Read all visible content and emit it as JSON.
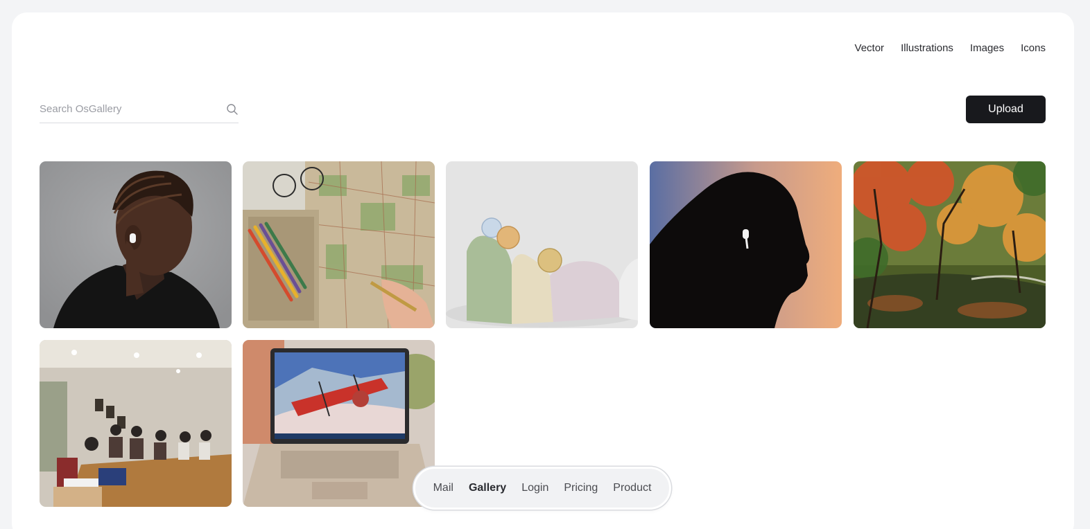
{
  "top_nav": {
    "items": [
      {
        "label": "Vector"
      },
      {
        "label": "Illustrations"
      },
      {
        "label": "Images"
      },
      {
        "label": "Icons"
      }
    ]
  },
  "search": {
    "placeholder": "Search OsGallery",
    "value": "",
    "icon": "search-icon"
  },
  "toolbar": {
    "upload_label": "Upload"
  },
  "gallery": {
    "items": [
      {
        "subject": "woman-with-earbud-gray"
      },
      {
        "subject": "map-with-pencils"
      },
      {
        "subject": "coins-on-sculpture"
      },
      {
        "subject": "silhouette-with-earbud"
      },
      {
        "subject": "autumn-trees-pond"
      },
      {
        "subject": "meeting-room"
      },
      {
        "subject": "laptop-biplane-wallpaper"
      }
    ]
  },
  "bottom_nav": {
    "items": [
      {
        "label": "Mail",
        "active": false
      },
      {
        "label": "Gallery",
        "active": true
      },
      {
        "label": "Login",
        "active": false
      },
      {
        "label": "Pricing",
        "active": false
      },
      {
        "label": "Product",
        "active": false
      }
    ]
  },
  "colors": {
    "page_bg": "#f3f4f6",
    "card_bg": "#ffffff",
    "button_bg": "#18191d",
    "button_text": "#ffffff"
  }
}
